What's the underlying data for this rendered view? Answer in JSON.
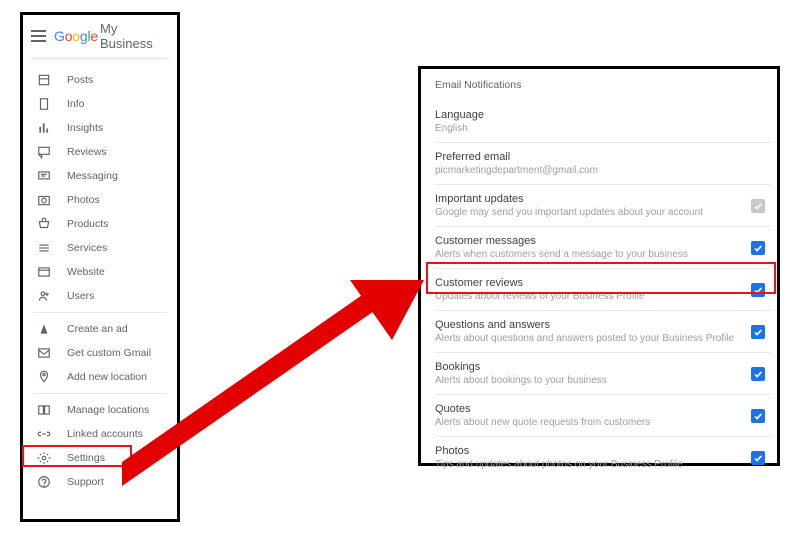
{
  "header": {
    "brand_google": "Google",
    "brand_rest": "My Business"
  },
  "sidebar": {
    "items": [
      {
        "icon": "post-icon",
        "label": "Posts"
      },
      {
        "icon": "info-icon",
        "label": "Info"
      },
      {
        "icon": "insights-icon",
        "label": "Insights"
      },
      {
        "icon": "reviews-icon",
        "label": "Reviews"
      },
      {
        "icon": "messaging-icon",
        "label": "Messaging"
      },
      {
        "icon": "photos-icon",
        "label": "Photos"
      },
      {
        "icon": "products-icon",
        "label": "Products"
      },
      {
        "icon": "services-icon",
        "label": "Services"
      },
      {
        "icon": "website-icon",
        "label": "Website"
      },
      {
        "icon": "users-icon",
        "label": "Users"
      }
    ],
    "items2": [
      {
        "icon": "ad-icon",
        "label": "Create an ad"
      },
      {
        "icon": "gmail-icon",
        "label": "Get custom Gmail"
      },
      {
        "icon": "location-icon",
        "label": "Add new location"
      }
    ],
    "items3": [
      {
        "icon": "manage-icon",
        "label": "Manage locations"
      },
      {
        "icon": "linked-icon",
        "label": "Linked accounts"
      },
      {
        "icon": "settings-icon",
        "label": "Settings"
      },
      {
        "icon": "support-icon",
        "label": "Support"
      }
    ]
  },
  "settings": {
    "section_title": "Email Notifications",
    "rows": [
      {
        "label": "Language",
        "desc": "English",
        "check": null
      },
      {
        "label": "Preferred email",
        "desc": "picmarketingdepartment@gmail.com",
        "check": null
      },
      {
        "label": "Important updates",
        "desc": "Google may send you important updates about your account",
        "check": "gray"
      },
      {
        "label": "Customer messages",
        "desc": "Alerts when customers send a message to your business",
        "check": "blue"
      },
      {
        "label": "Customer reviews",
        "desc": "Updates about reviews of your Business Profile",
        "check": "blue"
      },
      {
        "label": "Questions and answers",
        "desc": "Alerts about questions and answers posted to your Business Profile",
        "check": "blue"
      },
      {
        "label": "Bookings",
        "desc": "Alerts about bookings to your business",
        "check": "blue"
      },
      {
        "label": "Quotes",
        "desc": "Alerts about new quote requests from customers",
        "check": "blue"
      },
      {
        "label": "Photos",
        "desc": "Tips and updates about photos on your Business Profile",
        "check": "blue"
      }
    ]
  }
}
